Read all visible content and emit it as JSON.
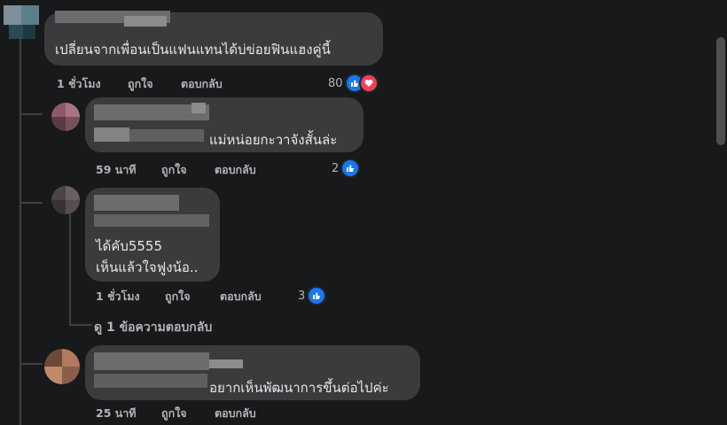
{
  "comments": [
    {
      "text": "เปลี่ยนจากเพื่อนเป็นแฟนแทนได้บ่ข่อยฟินแฮงคู่นี้",
      "time": "1 ชั่วโมง",
      "like": "ถูกใจ",
      "reply": "ตอบกลับ",
      "reaction_count": "80",
      "reactions": [
        "like-icon",
        "love-icon"
      ]
    },
    {
      "text": "แม่หน่อยกะวาจังสั้นล่ะ",
      "time": "59 นาที",
      "like": "ถูกใจ",
      "reply": "ตอบกลับ",
      "reaction_count": "2",
      "reactions": [
        "like-icon"
      ]
    },
    {
      "lines": [
        "ได้คับ5555",
        "เห็นแล้วใจฟูงน้อ.."
      ],
      "time": "1 ชั่วโมง",
      "like": "ถูกใจ",
      "reply": "ตอบกลับ",
      "reaction_count": "3",
      "reactions": [
        "like-icon"
      ]
    },
    {
      "text": "อยากเห็นพัฒนาการขึ้นต่อไปค่ะ",
      "time": "25 นาที",
      "like": "ถูกใจ",
      "reply": "ตอบกลับ"
    }
  ],
  "view_replies": "ดู 1 ข้อความตอบกลับ",
  "colors": {
    "background": "#18191a",
    "bubble": "#3a3b3c",
    "text": "#e4e6eb",
    "meta": "#b0b3b8",
    "like": "#1877f2",
    "love": "#f33e58"
  }
}
